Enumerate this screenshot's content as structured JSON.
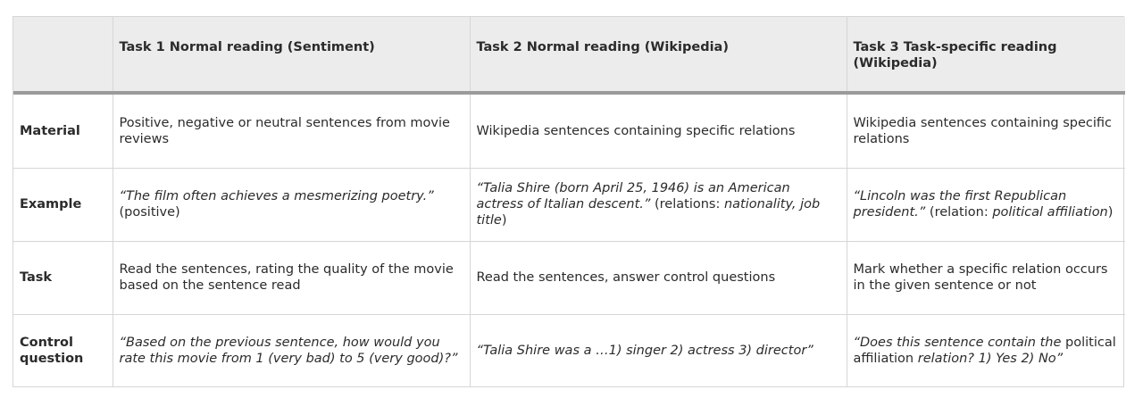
{
  "table": {
    "headers": [
      "",
      "Task 1 Normal reading (Sentiment)",
      "Task 2 Normal reading (Wikipedia)",
      "Task 3 Task-specific reading (Wikipedia)"
    ],
    "rows": [
      {
        "label": "Material",
        "cells": [
          "Positive, negative or neutral sentences from movie reviews",
          "Wikipedia sentences containing specific relations",
          "Wikipedia sentences containing specific relations"
        ]
      },
      {
        "label": "Example",
        "task1": {
          "quote": "“The film often achieves a mesmerizing poetry.”",
          "tail": "(positive)"
        },
        "task2": {
          "quote": "“Talia Shire (born April 25, 1946) is an American actress of Italian descent.”",
          "pre": " (relations: ",
          "rels": "nationality, job title",
          "post": ")"
        },
        "task3": {
          "quote": "“Lincoln was the first Republican president.”",
          "pre": " (relation: ",
          "rels": "political affiliation",
          "post": ")"
        }
      },
      {
        "label": "Task",
        "cells": [
          "Read the sentences, rating the quality of the movie based on the sentence read",
          "Read the sentences, answer control questions",
          "Mark whether a specific relation occurs in the given sentence or not"
        ]
      },
      {
        "label": "Control question",
        "task1": "“Based on the previous sentence, how would you rate this movie from 1 (very bad) to 5 (very good)?”",
        "task2": "“Talia Shire was a …1) singer 2) actress 3) director”",
        "task3": {
          "a": "“Does this sentence contain the ",
          "b": "political affiliation",
          "c": " relation? 1) Yes 2) No”"
        }
      }
    ]
  }
}
